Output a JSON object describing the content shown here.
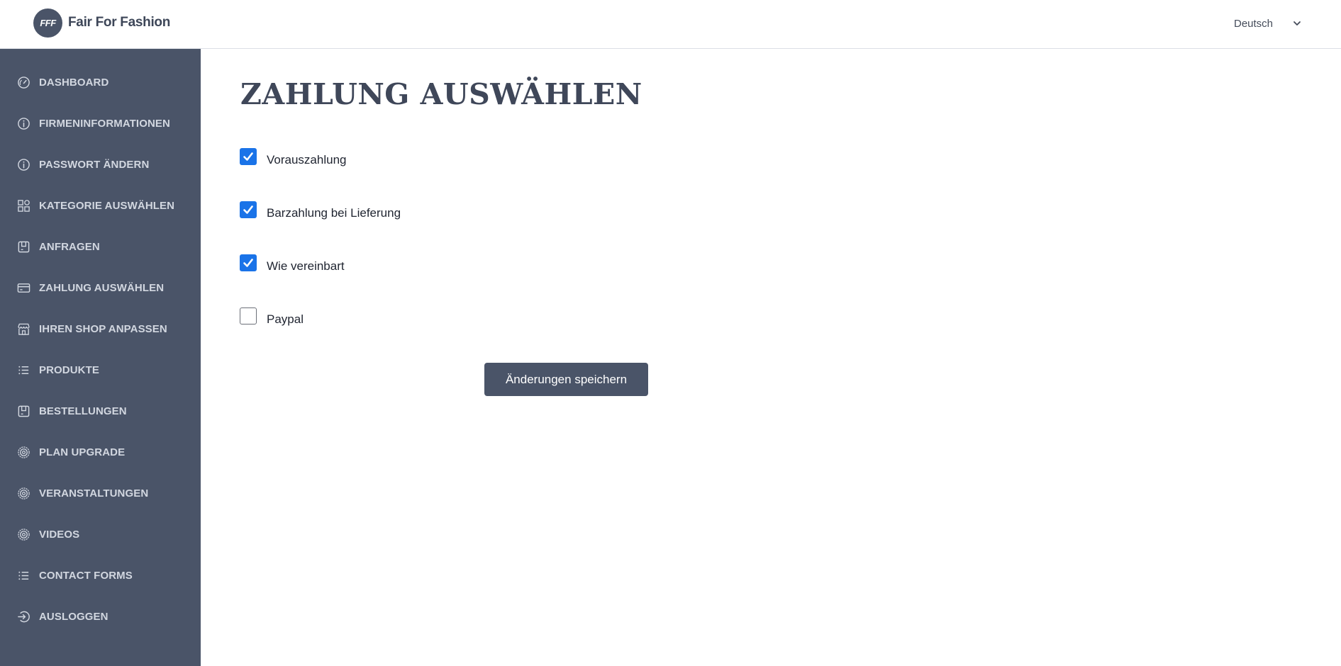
{
  "header": {
    "logo_mark": "FFF",
    "logo_text": "Fair For Fashion",
    "language": "Deutsch"
  },
  "sidebar": {
    "items": [
      {
        "label": "DASHBOARD",
        "icon": "dashboard-icon"
      },
      {
        "label": "FIRMENINFORMATIONEN",
        "icon": "info-icon"
      },
      {
        "label": "PASSWORT ÄNDERN",
        "icon": "info-icon"
      },
      {
        "label": "KATEGORIE AUSWÄHLEN",
        "icon": "category-icon"
      },
      {
        "label": "ANFRAGEN",
        "icon": "bag-icon"
      },
      {
        "label": "ZAHLUNG AUSWÄHLEN",
        "icon": "credit-card-icon"
      },
      {
        "label": "IHREN SHOP ANPASSEN",
        "icon": "store-icon"
      },
      {
        "label": "PRODUKTE",
        "icon": "list-icon"
      },
      {
        "label": "BESTELLUNGEN",
        "icon": "bag-icon"
      },
      {
        "label": "PLAN UPGRADE",
        "icon": "gear-icon"
      },
      {
        "label": "VERANSTALTUNGEN",
        "icon": "gear-icon"
      },
      {
        "label": "VIDEOS",
        "icon": "gear-icon"
      },
      {
        "label": "CONTACT FORMS",
        "icon": "list-icon"
      },
      {
        "label": "AUSLOGGEN",
        "icon": "logout-icon"
      }
    ]
  },
  "main": {
    "title": "ZAHLUNG AUSWÄHLEN",
    "options": [
      {
        "label": "Vorauszahlung",
        "checked": true
      },
      {
        "label": "Barzahlung bei Lieferung",
        "checked": true
      },
      {
        "label": "Wie vereinbart",
        "checked": true
      },
      {
        "label": "Paypal",
        "checked": false
      }
    ],
    "save_label": "Änderungen speichern"
  },
  "colors": {
    "sidebar_bg": "#4a5468",
    "sidebar_text": "#d2d7e0",
    "checkbox_accent": "#1a73e8",
    "button_bg": "#4a5468"
  }
}
